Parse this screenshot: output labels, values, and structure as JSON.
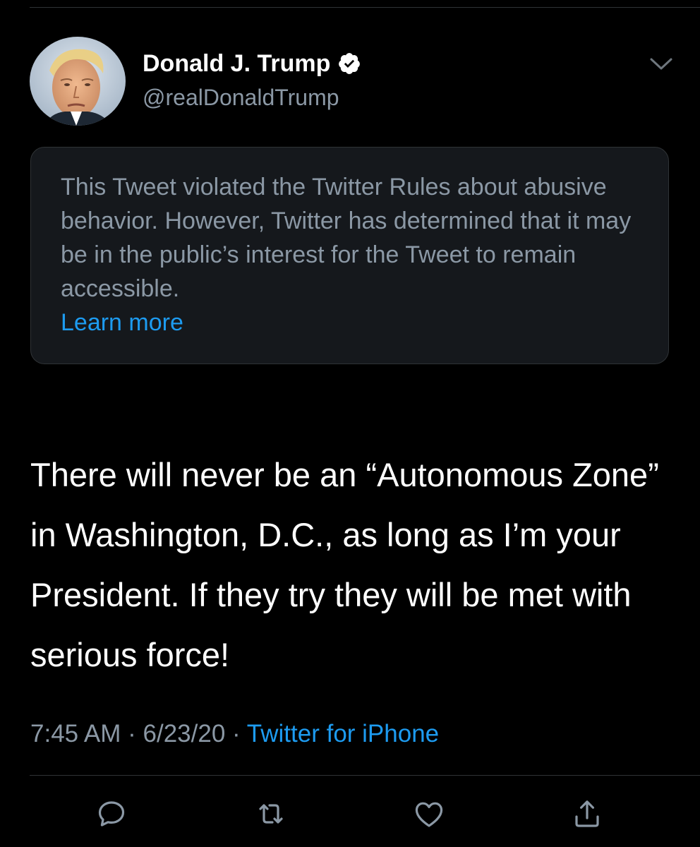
{
  "header": {
    "display_name": "Donald J. Trump",
    "handle": "@realDonaldTrump",
    "verified_icon": "verified-badge-icon",
    "menu_icon": "chevron-down-icon"
  },
  "notice": {
    "text": "This Tweet violated the Twitter Rules about abusive behavior. However, Twitter has determined that it may be in the public’s interest for the Tweet to remain accessible.",
    "link_label": "Learn more"
  },
  "tweet": {
    "text": "There will never be an “Autonomous Zone” in Washington, D.C., as long as I’m your President. If they try they will be met with serious force!"
  },
  "meta": {
    "time": "7:45 AM",
    "separator": " · ",
    "date": "6/23/20",
    "source": "Twitter for iPhone"
  },
  "actions": [
    {
      "icon": "reply-icon"
    },
    {
      "icon": "retweet-icon"
    },
    {
      "icon": "like-icon"
    },
    {
      "icon": "share-icon"
    }
  ],
  "colors": {
    "background": "#000000",
    "accent": "#1d9bf0",
    "secondary_text": "#8b98a5",
    "notice_background": "#15181c",
    "divider": "#2f3336"
  }
}
